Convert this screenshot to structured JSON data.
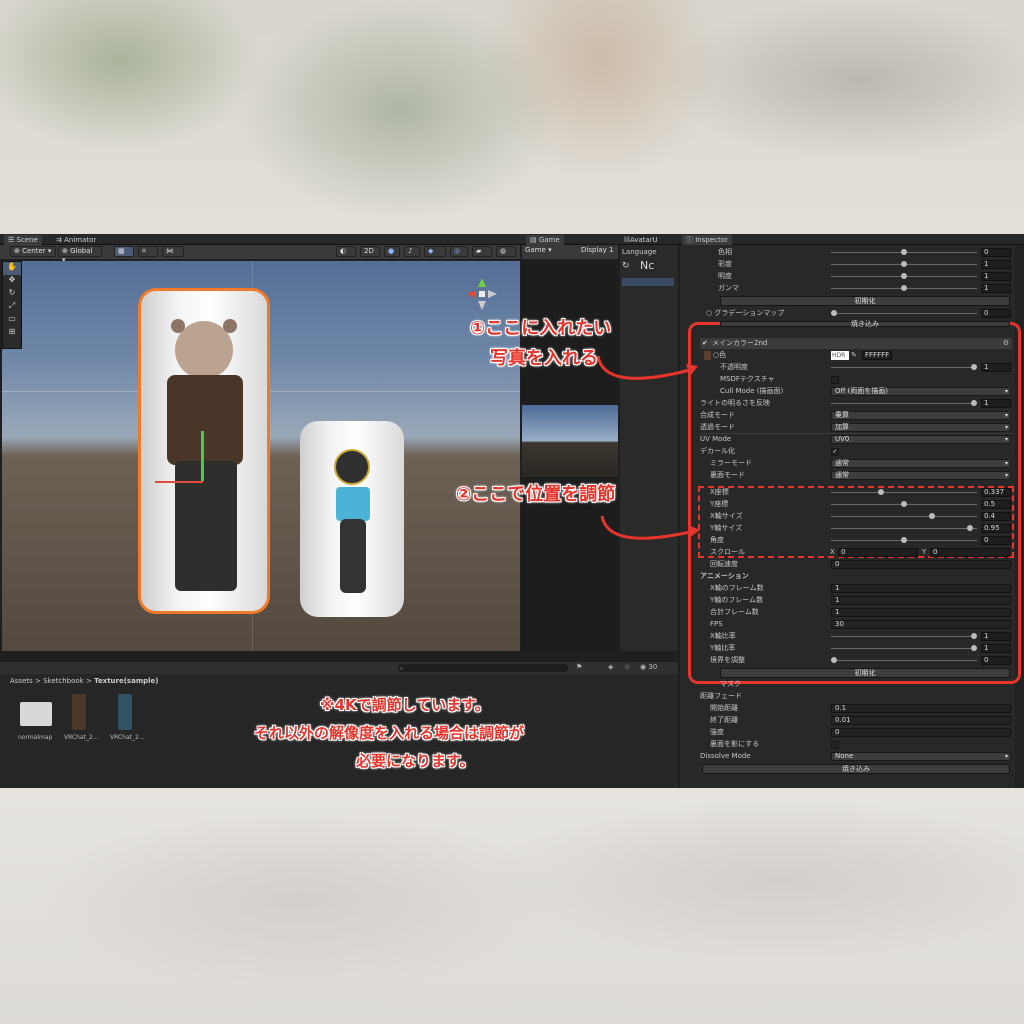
{
  "tabs": {
    "scene": "Scene",
    "animator": "Animator",
    "game": "Game",
    "avatar": "lilAvatarU",
    "inspector": "Inspector"
  },
  "scene_toolbar": {
    "pivot": "Center",
    "space": "Global",
    "mode_2d": "2D"
  },
  "game_bar": {
    "label": "Game",
    "display": "Display 1"
  },
  "avatar_panel": {
    "language": "Language",
    "nc": "Nc"
  },
  "inspector": {
    "top_rows": [
      {
        "label": "色相",
        "value": "0",
        "knob": 0.5
      },
      {
        "label": "彩度",
        "value": "1",
        "knob": 0.5
      },
      {
        "label": "明度",
        "value": "1",
        "knob": 0.5
      },
      {
        "label": "ガンマ",
        "value": "1",
        "knob": 0.5
      }
    ],
    "reset1": "初期化",
    "gradation": {
      "label": "○ グラデーションマップ",
      "value": "0"
    },
    "bake1": "焼き込み",
    "section_title": "メインカラー2nd",
    "color_label": "○色",
    "hdr": "HDR",
    "hex": "FFFFFF",
    "rows_a": [
      {
        "label": "不透明度",
        "type": "slider",
        "value": "1",
        "knob": 1.0
      },
      {
        "label": "MSDFテクスチャ",
        "type": "check",
        "value": ""
      },
      {
        "label": "Cull Mode (描画面)",
        "type": "drop",
        "value": "Off (両面を描画)"
      },
      {
        "label": "ライトの明るさを反映",
        "type": "slider",
        "value": "1",
        "knob": 1.0
      },
      {
        "label": "合成モード",
        "type": "drop",
        "value": "乗算"
      },
      {
        "label": "透過モード",
        "type": "drop",
        "value": "加算"
      },
      {
        "label": "UV Mode",
        "type": "drop",
        "value": "UV0"
      },
      {
        "label": "デカール化",
        "type": "check",
        "value": "✓"
      },
      {
        "label": "ミラーモード",
        "type": "drop",
        "value": "通常"
      },
      {
        "label": "裏面モード",
        "type": "drop",
        "value": "通常"
      }
    ],
    "rows_b": [
      {
        "label": "X座標",
        "value": "0.337",
        "knob": 0.337
      },
      {
        "label": "Y座標",
        "value": "0.5",
        "knob": 0.5
      },
      {
        "label": "X軸サイズ",
        "value": "0.4",
        "knob": 0.7
      },
      {
        "label": "Y軸サイズ",
        "value": "0.95",
        "knob": 0.97
      },
      {
        "label": "角度",
        "value": "0",
        "knob": 0.5
      }
    ],
    "scroll": {
      "label": "スクロール",
      "x_label": "X",
      "x_value": "0",
      "y_label": "Y",
      "y_value": "0"
    },
    "rotation": {
      "label": "回転速度",
      "value": "0"
    },
    "anim_header": "アニメーション",
    "rows_c": [
      {
        "label": "X軸のフレーム数",
        "type": "text",
        "value": "1"
      },
      {
        "label": "Y軸のフレーム数",
        "type": "text",
        "value": "1"
      },
      {
        "label": "合計フレーム数",
        "type": "text",
        "value": "1"
      },
      {
        "label": "FPS",
        "type": "text",
        "value": "30"
      },
      {
        "label": "X軸比率",
        "type": "slider",
        "value": "1",
        "knob": 1.0
      },
      {
        "label": "Y軸比率",
        "type": "slider",
        "value": "1",
        "knob": 1.0
      },
      {
        "label": "境界を調整",
        "type": "slider",
        "value": "0",
        "knob": 0.0
      }
    ],
    "reset2": "初期化",
    "mask": "マスク",
    "distance_fade": "距離フェード",
    "rows_d": [
      {
        "label": "開始距離",
        "type": "text",
        "value": "0.1"
      },
      {
        "label": "終了距離",
        "type": "text",
        "value": "0.01"
      },
      {
        "label": "強度",
        "type": "text",
        "value": "0"
      },
      {
        "label": "裏面を影にする",
        "type": "check",
        "value": ""
      }
    ],
    "dissolve": {
      "label": "Dissolve Mode",
      "value": "None"
    },
    "bake2": "焼き込み"
  },
  "project": {
    "breadcrumb": [
      "Assets",
      "Sketchbook",
      "Texture(sample)"
    ],
    "items": [
      "normalmap",
      "VRChat_2…",
      "VRChat_2…"
    ],
    "count": "30"
  },
  "annotations": {
    "a1_line1": "①ここに入れたい",
    "a1_line2": "写真を入れる",
    "a2": "②ここで位置を調節",
    "note_line1": "※4Kで調節しています。",
    "note_line2": "それ以外の解像度を入れる場合は調節が",
    "note_line3": "必要になります。"
  },
  "colors": {
    "accent_red": "#e5352d",
    "selection_orange": "#f07a2a",
    "unity_dark": "#282828"
  }
}
